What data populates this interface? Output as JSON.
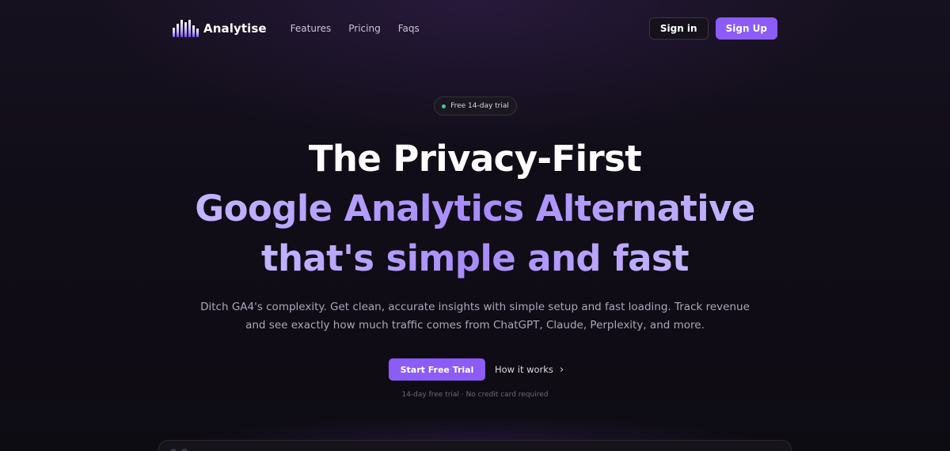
{
  "nav": {
    "brand": "Analytise",
    "links": [
      "Features",
      "Pricing",
      "Faqs"
    ],
    "sign_in": "Sign in",
    "sign_up": "Sign Up"
  },
  "hero": {
    "badge": "Free 14-day trial",
    "headline_line1": "The Privacy-First",
    "headline_line2": "Google Analytics Alternative",
    "headline_line3": "that's simple and fast",
    "subtitle": "Ditch GA4's complexity. Get clean, accurate insights with simple setup and fast loading. Track revenue and see exactly how much traffic comes from ChatGPT, Claude, Perplexity, and more.",
    "cta_primary": "Start Free Trial",
    "cta_secondary": "How it works",
    "note": "14-day free trial · No credit card required"
  },
  "colors": {
    "accent": "#8b5cf6",
    "headline_gradient": "#a78bfa",
    "badge_dot": "#34d399",
    "background": "#0d0b12"
  },
  "icons": {
    "logo": "bar-chart-logo-icon",
    "badge": "status-dot-icon",
    "cta_secondary": "chevron-right-icon"
  }
}
